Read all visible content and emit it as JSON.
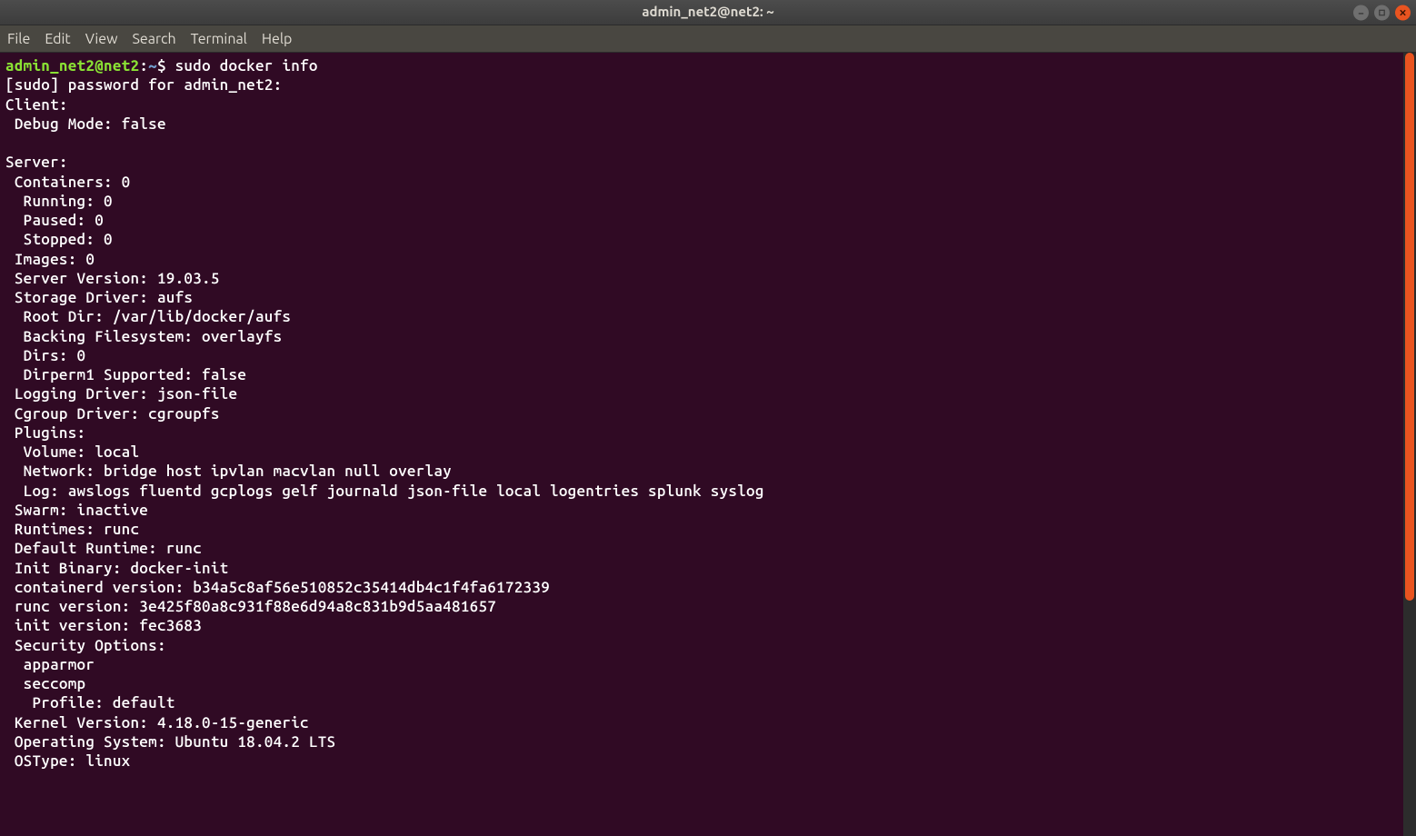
{
  "titlebar": {
    "title": "admin_net2@net2: ~"
  },
  "menubar": {
    "file": "File",
    "edit": "Edit",
    "view": "View",
    "search": "Search",
    "terminal": "Terminal",
    "help": "Help"
  },
  "prompt": {
    "user_host": "admin_net2@net2",
    "colon": ":",
    "path": "~",
    "dollar": "$ ",
    "command": "sudo docker info"
  },
  "lines": {
    "l01": "[sudo] password for admin_net2:",
    "l02": "Client:",
    "l03": " Debug Mode: false",
    "l04": "",
    "l05": "Server:",
    "l06": " Containers: 0",
    "l07": "  Running: 0",
    "l08": "  Paused: 0",
    "l09": "  Stopped: 0",
    "l10": " Images: 0",
    "l11": " Server Version: 19.03.5",
    "l12": " Storage Driver: aufs",
    "l13": "  Root Dir: /var/lib/docker/aufs",
    "l14": "  Backing Filesystem: overlayfs",
    "l15": "  Dirs: 0",
    "l16": "  Dirperm1 Supported: false",
    "l17": " Logging Driver: json-file",
    "l18": " Cgroup Driver: cgroupfs",
    "l19": " Plugins:",
    "l20": "  Volume: local",
    "l21": "  Network: bridge host ipvlan macvlan null overlay",
    "l22": "  Log: awslogs fluentd gcplogs gelf journald json-file local logentries splunk syslog",
    "l23": " Swarm: inactive",
    "l24": " Runtimes: runc",
    "l25": " Default Runtime: runc",
    "l26": " Init Binary: docker-init",
    "l27": " containerd version: b34a5c8af56e510852c35414db4c1f4fa6172339",
    "l28": " runc version: 3e425f80a8c931f88e6d94a8c831b9d5aa481657",
    "l29": " init version: fec3683",
    "l30": " Security Options:",
    "l31": "  apparmor",
    "l32": "  seccomp",
    "l33": "   Profile: default",
    "l34": " Kernel Version: 4.18.0-15-generic",
    "l35": " Operating System: Ubuntu 18.04.2 LTS",
    "l36": " OSType: linux"
  }
}
